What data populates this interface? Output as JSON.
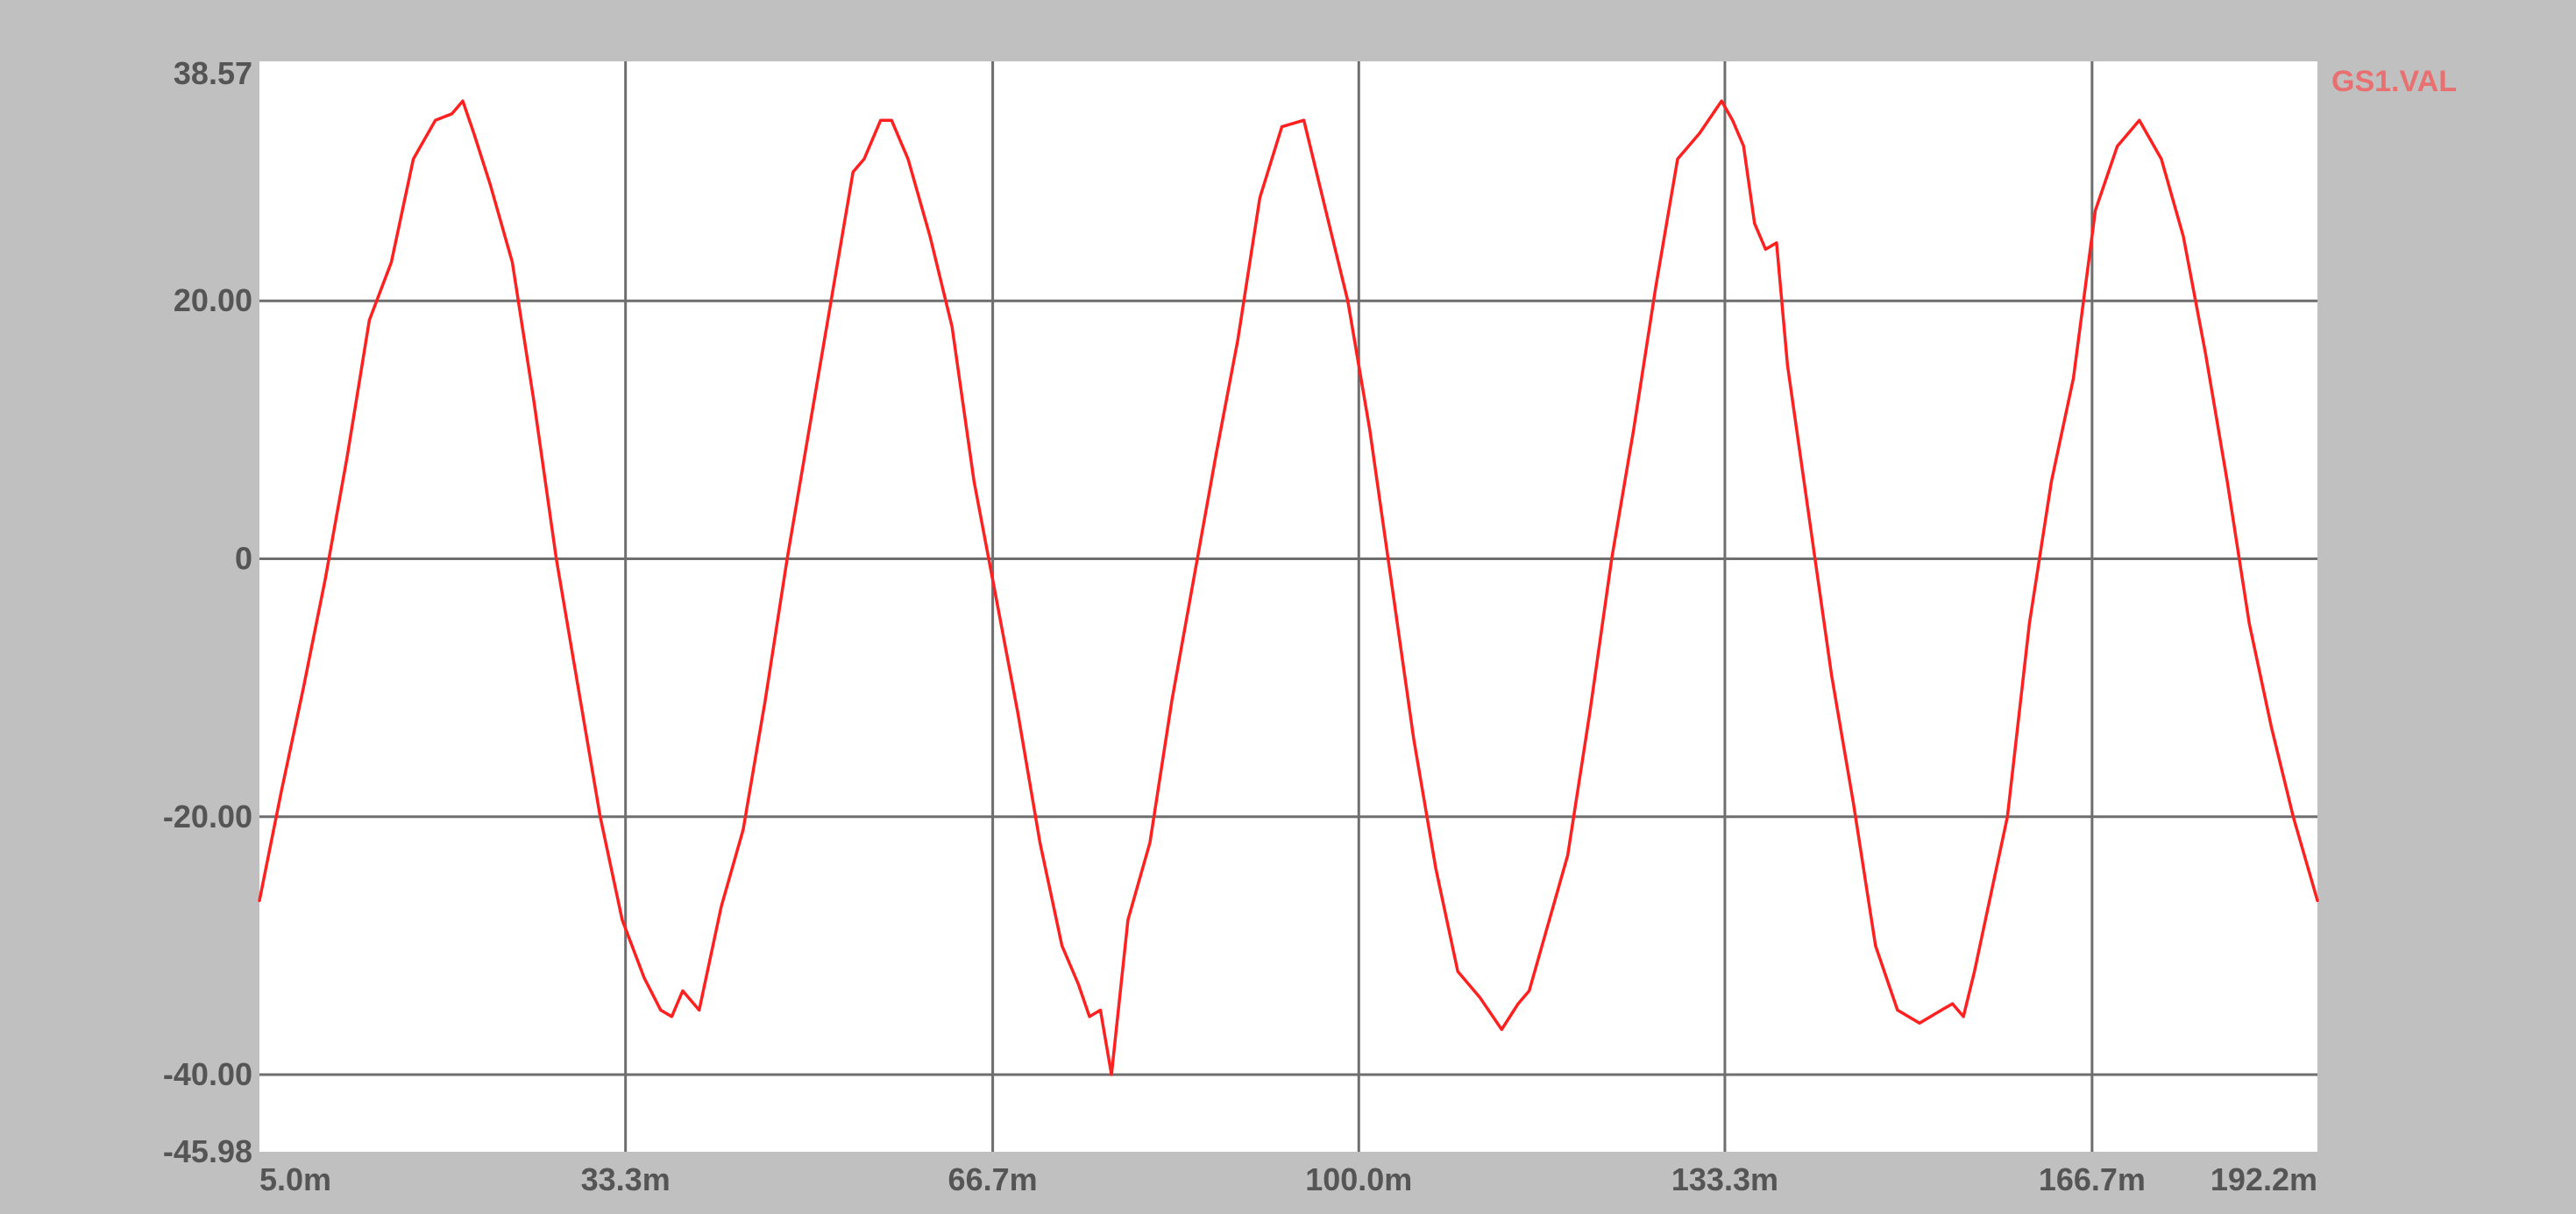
{
  "chart_data": {
    "type": "line",
    "colors": {
      "background": "#c0c0c0",
      "plot_background": "#ffffff",
      "grid": "#6e6e6e",
      "series": "#ff2020",
      "legend_text": "#e87070"
    },
    "grid": true,
    "legend_position": "top-right",
    "xlim": [
      5.0,
      192.2
    ],
    "ylim": [
      -45.98,
      38.57
    ],
    "x_ticks": [
      {
        "value": 5.0,
        "label": "5.0m"
      },
      {
        "value": 38.3,
        "label": "33.3m"
      },
      {
        "value": 71.7,
        "label": "66.7m"
      },
      {
        "value": 105.0,
        "label": "100.0m"
      },
      {
        "value": 138.3,
        "label": "133.3m"
      },
      {
        "value": 171.7,
        "label": "166.7m"
      },
      {
        "value": 192.2,
        "label": "192.2m"
      }
    ],
    "y_ticks": [
      {
        "value": 38.57,
        "label": "38.57"
      },
      {
        "value": 20,
        "label": "20.00"
      },
      {
        "value": 0,
        "label": "0"
      },
      {
        "value": -20,
        "label": "-20.00"
      },
      {
        "value": -40,
        "label": "-40.00"
      },
      {
        "value": -45.98,
        "label": "-45.98"
      }
    ],
    "series": [
      {
        "name": "GS1.VAL",
        "x": [
          5.0,
          7.0,
          9.0,
          11.0,
          13.0,
          15.0,
          17.0,
          19.0,
          21.0,
          22.5,
          23.5,
          24.5,
          26.0,
          28.0,
          30.0,
          32.0,
          34.0,
          36.0,
          38.0,
          40.0,
          41.5,
          42.5,
          43.5,
          45.0,
          47.0,
          49.0,
          51.0,
          53.0,
          55.0,
          57.0,
          59.0,
          60.0,
          61.5,
          62.5,
          64.0,
          66.0,
          68.0,
          70.0,
          72.0,
          74.0,
          76.0,
          78.0,
          79.5,
          80.5,
          81.5,
          82.5,
          84.0,
          86.0,
          88.0,
          90.0,
          92.0,
          94.0,
          96.0,
          98.0,
          100.0,
          102.0,
          104.0,
          106.0,
          108.0,
          110.0,
          112.0,
          114.0,
          116.0,
          118.0,
          119.5,
          120.5,
          122.0,
          124.0,
          126.0,
          128.0,
          130.0,
          132.0,
          134.0,
          136.0,
          138.0,
          139.0,
          140.0,
          141.0,
          142.0,
          143.0,
          144.0,
          146.0,
          148.0,
          150.0,
          152.0,
          154.0,
          156.0,
          158.0,
          159.0,
          160.0,
          161.0,
          162.0,
          164.0,
          166.0,
          168.0,
          170.0,
          172.0,
          174.0,
          176.0,
          178.0,
          180.0,
          182.0,
          184.0,
          186.0,
          188.0,
          190.0,
          192.2
        ],
        "y": [
          -26.5,
          -18.0,
          -10.0,
          -1.5,
          8.0,
          18.5,
          23.0,
          31.0,
          34.0,
          34.5,
          35.5,
          33.0,
          29.0,
          23.0,
          12.0,
          0.0,
          -10.0,
          -20.0,
          -28.0,
          -32.5,
          -35.0,
          -35.5,
          -33.5,
          -35.0,
          -27.0,
          -21.0,
          -11.0,
          0.0,
          10.0,
          20.0,
          30.0,
          31.0,
          34.0,
          34.0,
          31.0,
          25.0,
          18.0,
          6.0,
          -3.0,
          -12.0,
          -22.0,
          -30.0,
          -33.0,
          -35.5,
          -35.0,
          -40.0,
          -28.0,
          -22.0,
          -11.0,
          -1.5,
          8.0,
          17.0,
          28.0,
          33.5,
          34.0,
          27.0,
          20.0,
          10.0,
          -2.0,
          -14.0,
          -24.0,
          -32.0,
          -34.0,
          -36.5,
          -34.5,
          -33.5,
          -29.0,
          -23.0,
          -12.0,
          0.0,
          10.0,
          21.0,
          31.0,
          33.0,
          35.5,
          34.0,
          32.0,
          26.0,
          24.0,
          24.5,
          15.0,
          3.0,
          -9.0,
          -19.0,
          -30.0,
          -35.0,
          -36.0,
          -35.0,
          -34.5,
          -35.5,
          -32.0,
          -28.0,
          -20.0,
          -5.0,
          6.0,
          14.0,
          27.0,
          32.0,
          34.0,
          31.0,
          25.0,
          16.0,
          6.0,
          -5.0,
          -13.0,
          -20.0,
          -26.5
        ]
      }
    ]
  }
}
